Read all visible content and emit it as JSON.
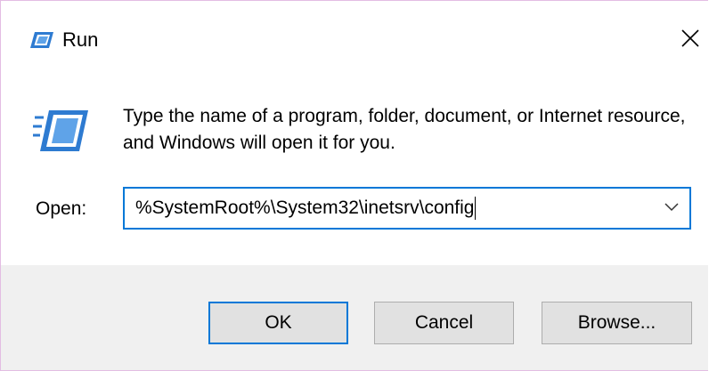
{
  "window": {
    "title": "Run",
    "icon": "run-icon",
    "close_icon": "close-icon"
  },
  "body": {
    "description": "Type the name of a program, folder, document, or Internet resource, and Windows will open it for you.",
    "open_label": "Open:",
    "open_value": "%SystemRoot%\\System32\\inetsrv\\config",
    "dropdown_icon": "chevron-down-icon"
  },
  "buttons": {
    "ok": "OK",
    "cancel": "Cancel",
    "browse": "Browse..."
  },
  "colors": {
    "accent": "#0078d7",
    "footer_bg": "#f0f0f0",
    "button_bg": "#e1e1e1"
  }
}
